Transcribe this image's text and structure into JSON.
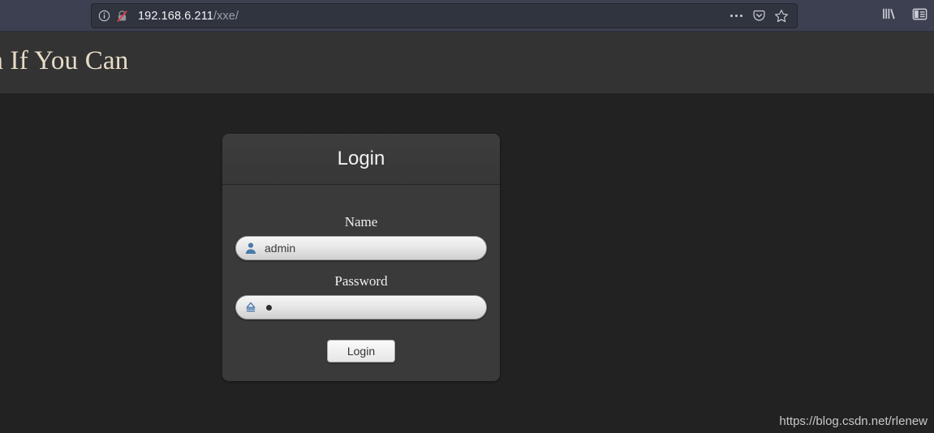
{
  "browser": {
    "url_host": "192.168.6.211",
    "url_path": "/xxe/",
    "icons": {
      "info": "info-icon",
      "insecure": "insecure-connection-icon",
      "page_actions": "ellipsis-icon",
      "pocket": "pocket-save-icon",
      "bookmark": "star-icon",
      "library": "library-icon",
      "sidebar": "sidebar-toggle-icon"
    }
  },
  "page": {
    "header_title": "in If You Can",
    "watermark": "https://blog.csdn.net/rlenew"
  },
  "login_panel": {
    "title": "Login",
    "name_label": "Name",
    "name_value": "admin",
    "name_icon": "user-icon",
    "password_label": "Password",
    "password_value": "•",
    "password_icon": "padlock-icon",
    "submit_label": "Login"
  },
  "colors": {
    "chrome_bg": "#3c4050",
    "page_bg": "#222222",
    "header_band_bg": "#333333",
    "panel_bg": "#3a3a3a",
    "header_title_color": "#e8dcc8",
    "field_icon_blue": "#4a7aab"
  }
}
